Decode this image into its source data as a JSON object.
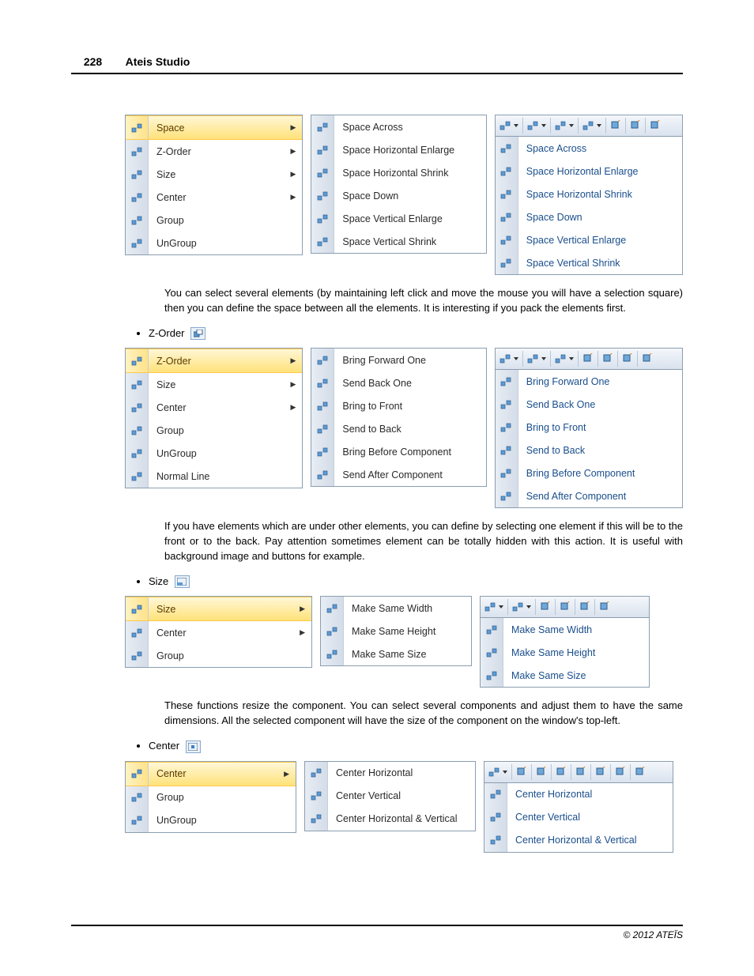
{
  "header": {
    "page": "228",
    "title": "Ateis Studio"
  },
  "footer": {
    "copyright": "© 2012 ATEÏS"
  },
  "section_space": {
    "menu_a": [
      {
        "label": "Space",
        "selected": true,
        "arrow": true
      },
      {
        "label": "Z-Order",
        "arrow": true
      },
      {
        "label": "Size",
        "arrow": true
      },
      {
        "label": "Center",
        "arrow": true
      },
      {
        "label": "Group"
      },
      {
        "label": "UnGroup"
      }
    ],
    "menu_b": [
      {
        "label": "Space Across"
      },
      {
        "label": "Space Horizontal Enlarge"
      },
      {
        "label": "Space Horizontal Shrink"
      },
      {
        "label": "Space Down"
      },
      {
        "label": "Space Vertical Enlarge"
      },
      {
        "label": "Space Vertical Shrink"
      }
    ],
    "panel": [
      {
        "label": "Space Across"
      },
      {
        "label": "Space Horizontal Enlarge"
      },
      {
        "label": "Space Horizontal Shrink"
      },
      {
        "label": "Space Down"
      },
      {
        "label": "Space Vertical Enlarge"
      },
      {
        "label": "Space Vertical Shrink"
      }
    ],
    "para": "You can select several elements (by maintaining left click and move the mouse you will have a selection square) then you can define the space between all the elements. It is interesting if you pack the elements first."
  },
  "bullet_zorder": "Z-Order",
  "section_zorder": {
    "menu_a": [
      {
        "label": "Z-Order",
        "selected": true,
        "arrow": true
      },
      {
        "label": "Size",
        "arrow": true
      },
      {
        "label": "Center",
        "arrow": true
      },
      {
        "label": "Group"
      },
      {
        "label": "UnGroup"
      },
      {
        "label": "Normal Line"
      }
    ],
    "menu_b": [
      {
        "label": "Bring Forward One"
      },
      {
        "label": "Send Back One"
      },
      {
        "label": "Bring to Front"
      },
      {
        "label": "Send to Back"
      },
      {
        "label": "Bring Before Component"
      },
      {
        "label": "Send After Component"
      }
    ],
    "panel": [
      {
        "label": "Bring Forward One"
      },
      {
        "label": "Send Back One"
      },
      {
        "label": "Bring to Front"
      },
      {
        "label": "Send to Back"
      },
      {
        "label": "Bring Before Component"
      },
      {
        "label": "Send After Component"
      }
    ],
    "para": "If you have elements which are under other elements, you can define by selecting one element if this will be to the front or to the back. Pay attention sometimes element can be totally hidden with this action. It is useful with background image and buttons for example."
  },
  "bullet_size": "Size",
  "section_size": {
    "menu_a": [
      {
        "label": "Size",
        "selected": true,
        "arrow": true
      },
      {
        "label": "Center",
        "arrow": true
      },
      {
        "label": "Group"
      }
    ],
    "menu_b": [
      {
        "label": "Make Same Width"
      },
      {
        "label": "Make Same Height"
      },
      {
        "label": "Make Same Size"
      }
    ],
    "panel": [
      {
        "label": "Make Same Width"
      },
      {
        "label": "Make Same Height"
      },
      {
        "label": "Make Same Size"
      }
    ],
    "para": "These functions resize the component. You can select several components and adjust them to have the same dimensions.  All the selected component will have the size of the component on the window's top-left."
  },
  "bullet_center": "Center",
  "section_center": {
    "menu_a": [
      {
        "label": "Center",
        "selected": true,
        "arrow": true
      },
      {
        "label": "Group"
      },
      {
        "label": "UnGroup"
      }
    ],
    "menu_b": [
      {
        "label": "Center Horizontal"
      },
      {
        "label": "Center Vertical"
      },
      {
        "label": "Center Horizontal & Vertical"
      }
    ],
    "panel": [
      {
        "label": "Center Horizontal"
      },
      {
        "label": "Center Vertical"
      },
      {
        "label": "Center Horizontal & Vertical"
      }
    ]
  },
  "toolbar_space": {
    "drops": 4,
    "btns": 3
  },
  "toolbar_zorder": {
    "drops": 3,
    "btns": 4
  },
  "toolbar_size": {
    "drops": 2,
    "btns": 4
  },
  "toolbar_center": {
    "drops": 1,
    "btns": 7
  }
}
